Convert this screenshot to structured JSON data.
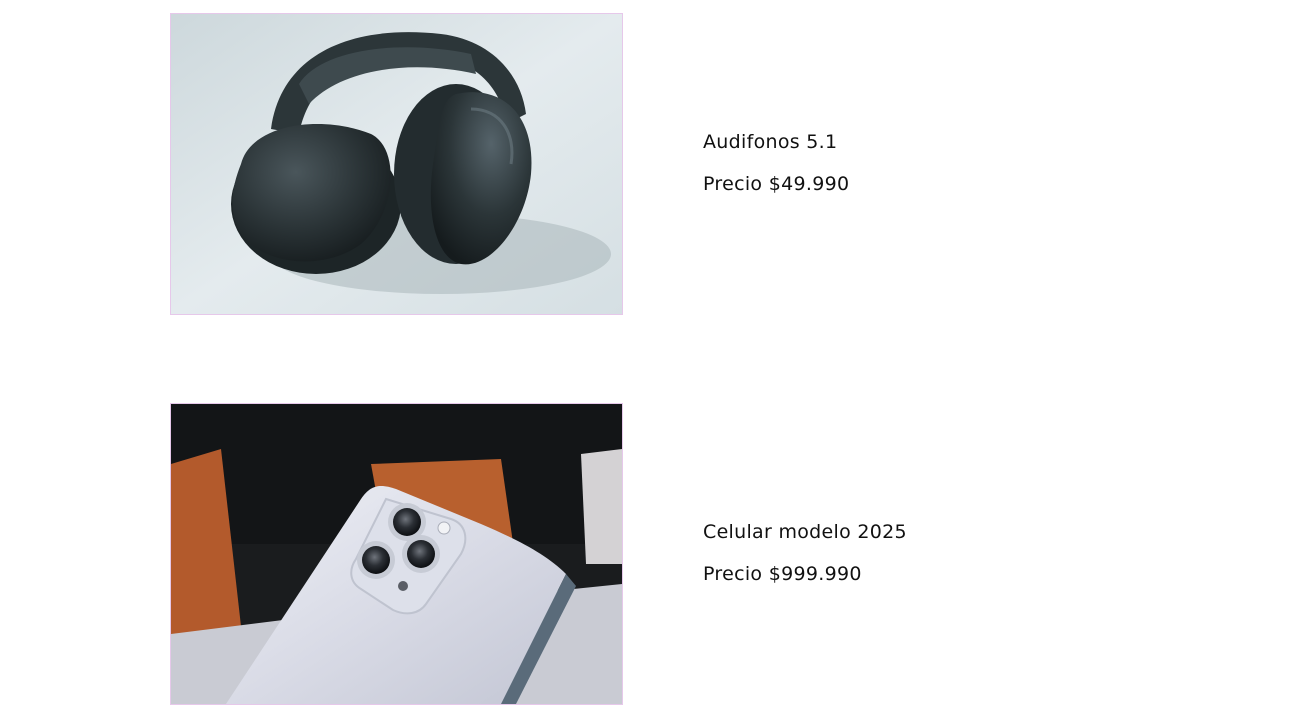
{
  "products": [
    {
      "name": "Audifonos 5.1",
      "price": "Precio $49.990",
      "image_icon": "headphones-photo"
    },
    {
      "name": "Celular modelo 2025",
      "price": "Precio $999.990",
      "image_icon": "smartphone-photo"
    }
  ],
  "colors": {
    "image_border": "#e6c8ea",
    "text": "#111111",
    "background": "#ffffff"
  }
}
